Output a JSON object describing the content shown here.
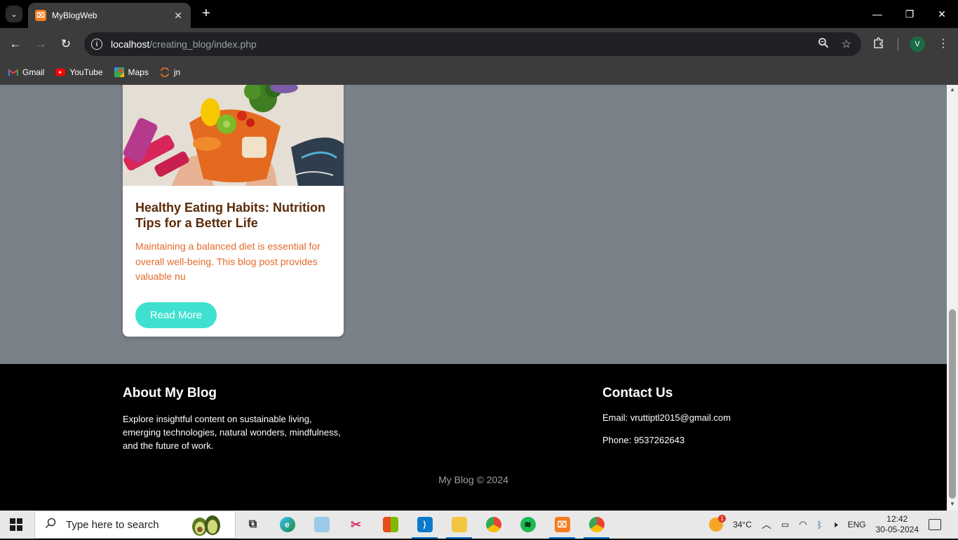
{
  "browser": {
    "tab_title": "MyBlogWeb",
    "tab_favicon_text": "⌧",
    "url_host": "localhost",
    "url_path": "/creating_blog/index.php",
    "avatar_letter": "V",
    "bookmarks": [
      {
        "label": "Gmail",
        "icon": "gmail-icon"
      },
      {
        "label": "YouTube",
        "icon": "youtube-icon"
      },
      {
        "label": "Maps",
        "icon": "maps-icon"
      },
      {
        "label": "jn",
        "icon": "jn-icon"
      }
    ]
  },
  "card": {
    "title": "Healthy Eating Habits: Nutrition Tips for a Better Life",
    "excerpt": "Maintaining a balanced diet is essential for overall well-being. This blog post provides valuable nu",
    "button_label": "Read More"
  },
  "footer": {
    "about_heading": "About My Blog",
    "about_text": "Explore insightful content on sustainable living, emerging technologies, natural wonders, mindfulness, and the future of work.",
    "contact_heading": "Contact Us",
    "email_line": "Email: vruttiptl2015@gmail.com",
    "phone_line": "Phone: 9537262643",
    "copyright": "My Blog © 2024"
  },
  "taskbar": {
    "search_placeholder": "Type here to search",
    "weather_badge": "1",
    "temperature": "34°C",
    "language": "ENG",
    "time": "12:42",
    "date": "30-05-2024"
  },
  "colors": {
    "page_bg": "#7a8189",
    "card_title": "#5b2b09",
    "card_excerpt": "#e36a2b",
    "button_bg": "#40e0d0",
    "footer_bg": "#000000"
  }
}
